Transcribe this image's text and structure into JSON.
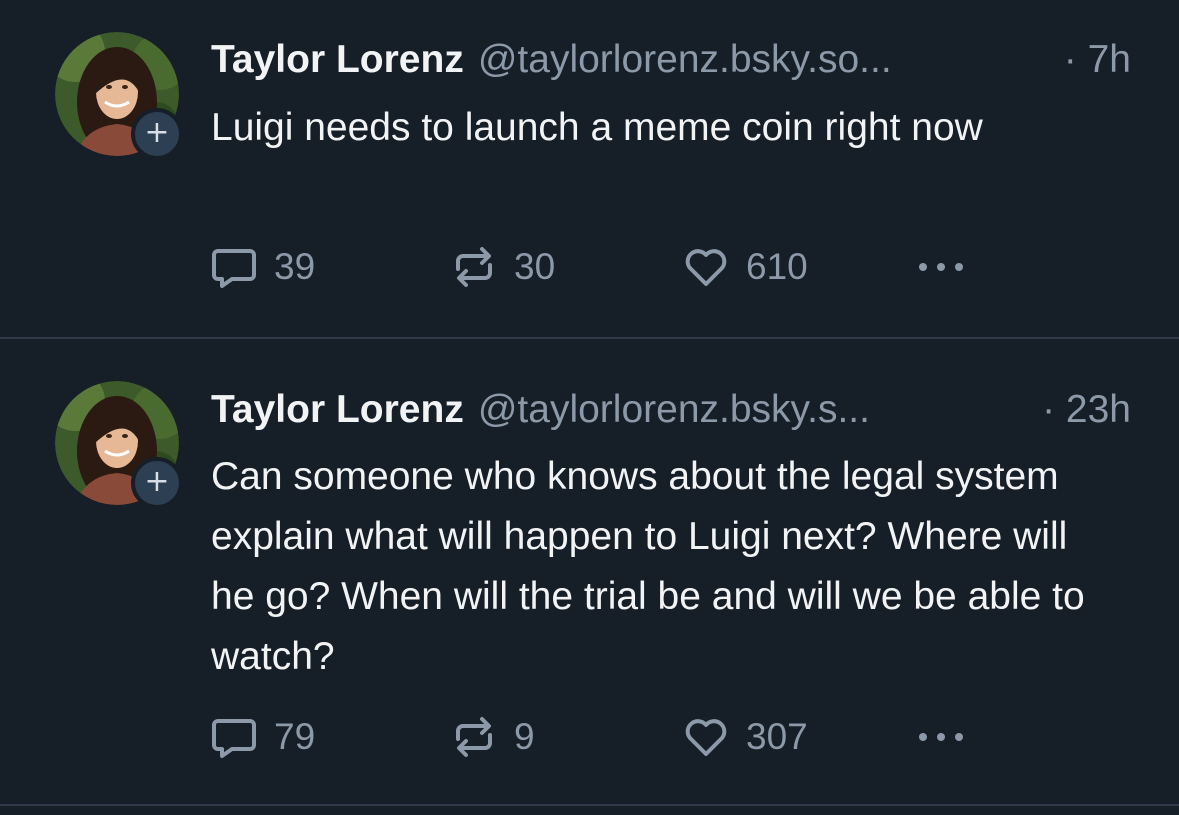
{
  "posts": [
    {
      "author": "Taylor Lorenz",
      "handle": "@taylorlorenz.bsky.so...",
      "time": "· 7h",
      "text": "Luigi needs to launch a meme coin right now",
      "replies": "39",
      "reposts": "30",
      "likes": "610",
      "follow_badge": "+"
    },
    {
      "author": "Taylor Lorenz",
      "handle": "@taylorlorenz.bsky.s...",
      "time": "· 23h",
      "text": "Can someone who knows about the legal system explain what will happen to Luigi next? Where will he go? When will the trial be and will we be able to watch?",
      "replies": "79",
      "reposts": "9",
      "likes": "307",
      "follow_badge": "+"
    }
  ],
  "icons": {
    "reply": "reply-icon",
    "repost": "repost-icon",
    "like": "heart-icon",
    "more": "more-icon",
    "follow": "plus-icon"
  },
  "colors": {
    "background": "#161e27",
    "text_primary": "#f1f3f5",
    "text_muted": "#8b99a8",
    "divider": "#2e3a48",
    "badge": "#2d3f52"
  }
}
